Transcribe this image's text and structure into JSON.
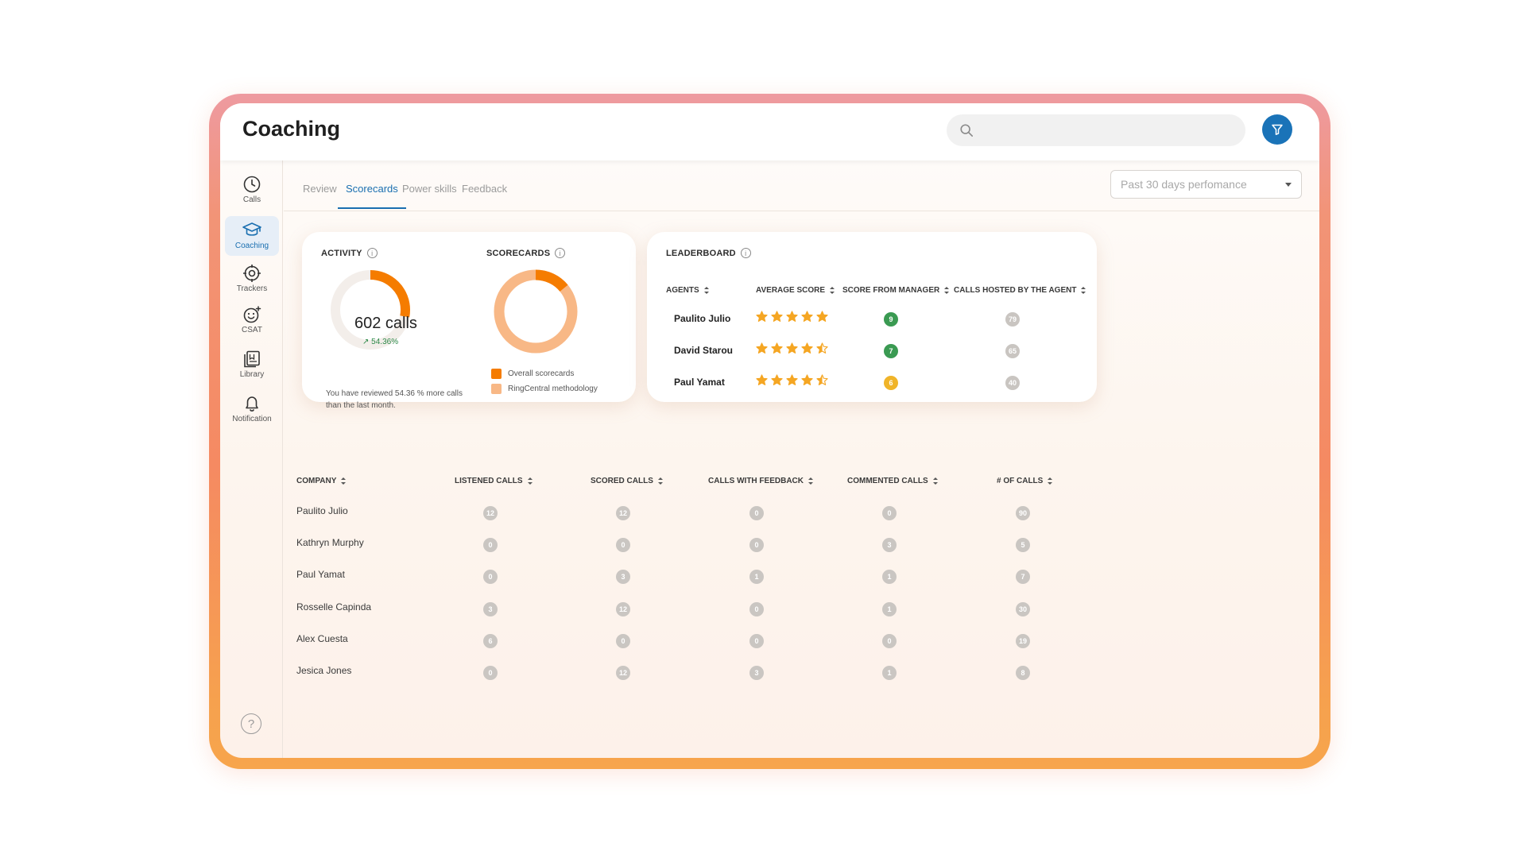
{
  "app": {
    "title": "Coaching",
    "search_placeholder": "",
    "filter_icon": "filter-icon"
  },
  "sidebar": {
    "items": [
      {
        "label": "Calls",
        "icon": "clock-icon"
      },
      {
        "label": "Coaching",
        "icon": "graduation-cap-icon",
        "active": true
      },
      {
        "label": "Trackers",
        "icon": "target-icon"
      },
      {
        "label": "CSAT",
        "icon": "smiley-icon"
      },
      {
        "label": "Library",
        "icon": "library-icon"
      },
      {
        "label": "Notification",
        "icon": "bell-icon"
      }
    ],
    "help": "?"
  },
  "tabs": [
    {
      "label": "Review"
    },
    {
      "label": "Scorecards",
      "active": true
    },
    {
      "label": "Power skills"
    },
    {
      "label": "Feedback"
    }
  ],
  "period": {
    "selected": "Past 30 days perfomance"
  },
  "activity": {
    "title": "ACTIVITY",
    "value": "602 calls",
    "delta": "54.36%",
    "progress": 0.28,
    "note": "You have reviewed 54.36 % more calls than the last month."
  },
  "scorecards": {
    "title": "SCORECARDS",
    "overall_fraction": 0.14,
    "legend": [
      {
        "label": "Overall scorecards",
        "color": "#f57c00"
      },
      {
        "label": "RingCentral methodology",
        "color": "#f8b886"
      }
    ]
  },
  "leaderboard": {
    "title": "LEADERBOARD",
    "columns": [
      "AGENTS",
      "AVERAGE SCORE",
      "SCORE FROM MANAGER",
      "CALLS HOSTED BY THE AGENT"
    ],
    "rows": [
      {
        "agent": "Paulito Julio",
        "stars": 5,
        "manager": "9",
        "manager_color": "#3a9a52",
        "calls": "79"
      },
      {
        "agent": "David Starou",
        "stars": 4.5,
        "manager": "7",
        "manager_color": "#3a9a52",
        "calls": "65"
      },
      {
        "agent": "Paul Yamat",
        "stars": 4.5,
        "manager": "6",
        "manager_color": "#f0b429",
        "calls": "40"
      }
    ]
  },
  "company_table": {
    "columns": [
      "COMPANY",
      "LISTENED CALLS",
      "SCORED CALLS",
      "CALLS WITH FEEDBACK",
      "COMMENTED CALLS",
      "# OF CALLS"
    ],
    "rows": [
      {
        "name": "Paulito Julio",
        "values": [
          "12",
          "12",
          "0",
          "0",
          "90"
        ]
      },
      {
        "name": "Kathryn Murphy",
        "values": [
          "0",
          "0",
          "0",
          "3",
          "5"
        ]
      },
      {
        "name": "Paul Yamat",
        "values": [
          "0",
          "3",
          "1",
          "1",
          "7"
        ]
      },
      {
        "name": "Rosselle Capinda",
        "values": [
          "3",
          "12",
          "0",
          "1",
          "30"
        ]
      },
      {
        "name": "Alex Cuesta",
        "values": [
          "6",
          "0",
          "0",
          "0",
          "19"
        ]
      },
      {
        "name": "Jesica Jones",
        "values": [
          "0",
          "12",
          "3",
          "1",
          "8"
        ]
      }
    ]
  }
}
